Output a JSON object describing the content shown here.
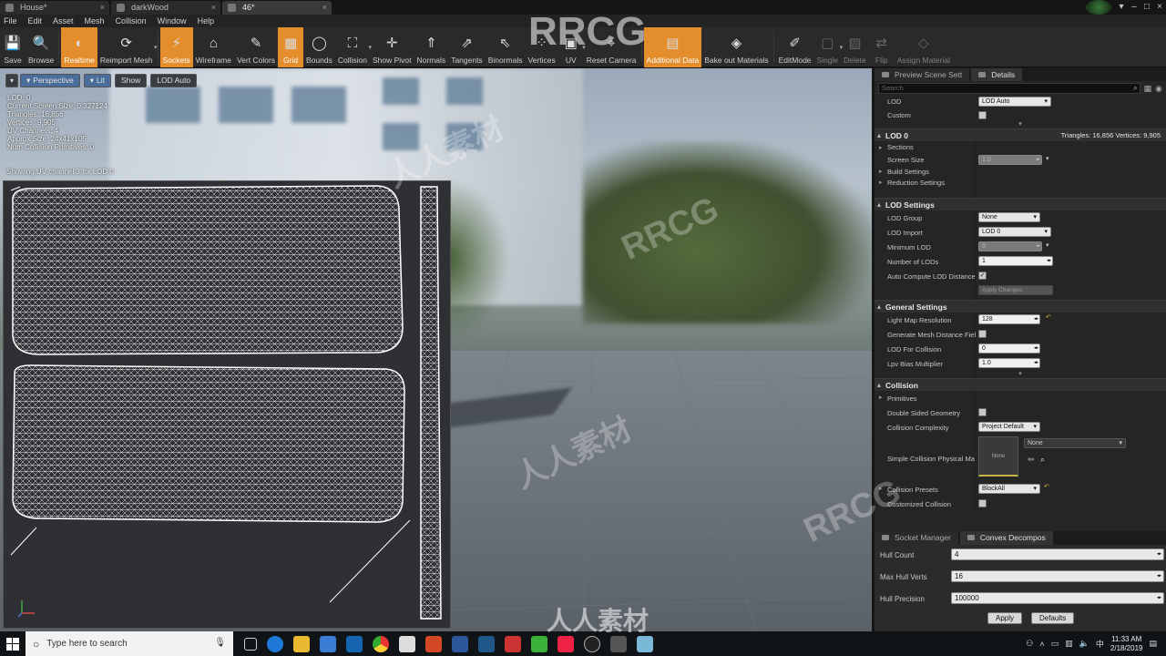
{
  "tabs": [
    {
      "label": "House*",
      "active": false
    },
    {
      "label": "darkWood",
      "active": false
    },
    {
      "label": "46*",
      "active": true
    }
  ],
  "menu": [
    "File",
    "Edit",
    "Asset",
    "Mesh",
    "Collision",
    "Window",
    "Help"
  ],
  "toolbar": [
    {
      "label": "Save",
      "icon": "save-icon",
      "state": "normal"
    },
    {
      "label": "Browse",
      "icon": "browse-icon",
      "state": "normal"
    },
    {
      "label": "Realtime",
      "icon": "realtime-icon",
      "state": "on"
    },
    {
      "label": "Reimport Mesh",
      "icon": "reimport-icon",
      "state": "normal"
    },
    {
      "label": "Sockets",
      "icon": "sockets-icon",
      "state": "on"
    },
    {
      "label": "Wireframe",
      "icon": "wireframe-icon",
      "state": "normal"
    },
    {
      "label": "Vert Colors",
      "icon": "vert-colors-icon",
      "state": "normal"
    },
    {
      "label": "Grid",
      "icon": "grid-icon",
      "state": "on"
    },
    {
      "label": "Bounds",
      "icon": "bounds-icon",
      "state": "normal"
    },
    {
      "label": "Collision",
      "icon": "collision-icon",
      "state": "normal"
    },
    {
      "label": "Show Pivot",
      "icon": "pivot-icon",
      "state": "normal"
    },
    {
      "label": "Normals",
      "icon": "normals-icon",
      "state": "normal"
    },
    {
      "label": "Tangents",
      "icon": "tangents-icon",
      "state": "normal"
    },
    {
      "label": "Binormals",
      "icon": "binormals-icon",
      "state": "normal"
    },
    {
      "label": "Vertices",
      "icon": "vertices-icon",
      "state": "normal"
    },
    {
      "label": "UV",
      "icon": "uv-icon",
      "state": "normal"
    },
    {
      "label": "Reset Camera",
      "icon": "camera-icon",
      "state": "normal"
    },
    {
      "label": "Additional Data",
      "icon": "additional-data-icon",
      "state": "on"
    },
    {
      "label": "Bake out Materials",
      "icon": "bake-icon",
      "state": "normal"
    },
    {
      "label": "EditMode",
      "icon": "editmode-icon",
      "state": "normal"
    },
    {
      "label": "Single",
      "icon": "single-icon",
      "state": "dim"
    },
    {
      "label": "Delete",
      "icon": "delete-icon",
      "state": "dim"
    },
    {
      "label": "Flip",
      "icon": "flip-icon",
      "state": "dim"
    },
    {
      "label": "Assign Material",
      "icon": "assign-material-icon",
      "state": "dim"
    }
  ],
  "viewport": {
    "buttons": {
      "perspective": "Perspective",
      "lit": "Lit",
      "show": "Show",
      "lod": "LOD Auto"
    },
    "stats": [
      "LOD:  0",
      "Current Screen Size:  0.327124",
      "Triangles:  16,856",
      "Vertices:  9,905",
      "UV Channels:  4",
      "Approx Size: 24x41x105",
      "Num Collision Primitives:  0"
    ],
    "uv_info": "Showing UV channel 3 for LOD 0"
  },
  "panel": {
    "tabs": [
      "Preview Scene Sett",
      "Details"
    ],
    "search_placeholder": "Search",
    "lod_top": {
      "lod_label": "LOD",
      "lod_value": "LOD Auto",
      "custom_label": "Custom"
    },
    "lod0": {
      "title": "LOD 0",
      "summary": "Triangles: 16,856   Vertices: 9,905",
      "sections": "Sections",
      "screen_size_label": "Screen Size",
      "screen_size_value": "1.0",
      "build_settings": "Build Settings",
      "reduction_settings": "Reduction Settings"
    },
    "lod_settings": {
      "title": "LOD Settings",
      "lod_group_label": "LOD Group",
      "lod_group_value": "None",
      "lod_import_label": "LOD Import",
      "lod_import_value": "LOD 0",
      "min_lod_label": "Minimum LOD",
      "min_lod_value": "0",
      "num_lods_label": "Number of LODs",
      "num_lods_value": "1",
      "auto_compute_label": "Auto Compute LOD Distance",
      "apply_changes": "Apply Changes"
    },
    "general": {
      "title": "General Settings",
      "lightmap_label": "Light Map Resolution",
      "lightmap_value": "128",
      "gen_mesh_dist_label": "Generate Mesh Distance Fiel",
      "lod_collision_label": "LOD For Collision",
      "lod_collision_value": "0",
      "lpv_label": "Lpv Bias Multiplier",
      "lpv_value": "1.0"
    },
    "collision": {
      "title": "Collision",
      "primitives": "Primitives",
      "double_sided_label": "Double Sided Geometry",
      "complexity_label": "Collision Complexity",
      "complexity_value": "Project Default",
      "phys_mat_label": "Simple Collision Physical Ma",
      "phys_mat_thumb": "None",
      "phys_mat_value": "None",
      "presets_label": "Collision Presets",
      "presets_value": "BlockAll",
      "customized_label": "Customized Collision"
    },
    "bottom": {
      "tabs": [
        "Socket Manager",
        "Convex Decompos"
      ],
      "hull_count_label": "Hull Count",
      "hull_count_value": "4",
      "max_hull_verts_label": "Max Hull Verts",
      "max_hull_verts_value": "16",
      "hull_precision_label": "Hull Precision",
      "hull_precision_value": "100000",
      "apply": "Apply",
      "defaults": "Defaults"
    }
  },
  "taskbar": {
    "search_placeholder": "Type here to search",
    "time": "11:33 AM",
    "date": "2/18/2019"
  },
  "watermarks": [
    "RRCG",
    "人人素材",
    "RRCG",
    "人人素材",
    "RRCG",
    "人人素材"
  ],
  "colors": {
    "accent": "#e38d2c",
    "panel": "#252525"
  }
}
